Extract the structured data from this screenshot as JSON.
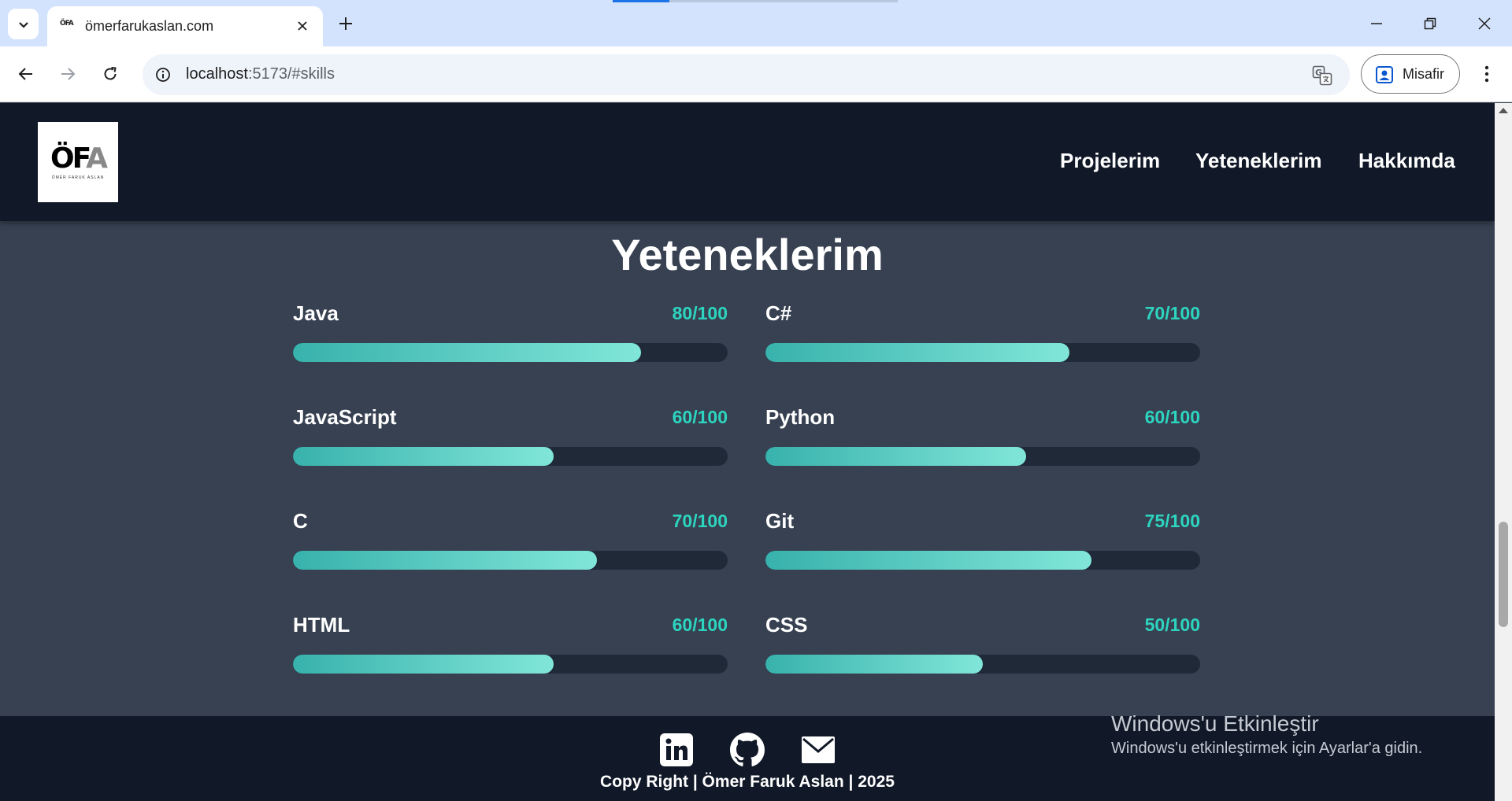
{
  "browser": {
    "tab_title": "ömerfarukaslan.com",
    "favicon_text": "ÖFA",
    "url_host": "localhost",
    "url_path": ":5173/#skills",
    "profile_label": "Misafir"
  },
  "navbar": {
    "logo_mark": "ÖF",
    "logo_mark_accent": "A",
    "logo_sub": "ÖMER FARUK ASLAN",
    "links": [
      "Projelerim",
      "Yeteneklerim",
      "Hakkımda"
    ]
  },
  "skills": {
    "title": "Yeteneklerim",
    "items": [
      {
        "name": "Java",
        "score": "80/100",
        "level": 80
      },
      {
        "name": "C#",
        "score": "70/100",
        "level": 70
      },
      {
        "name": "JavaScript",
        "score": "60/100",
        "level": 60
      },
      {
        "name": "Python",
        "score": "60/100",
        "level": 60
      },
      {
        "name": "C",
        "score": "70/100",
        "level": 70
      },
      {
        "name": "Git",
        "score": "75/100",
        "level": 75
      },
      {
        "name": "HTML",
        "score": "60/100",
        "level": 60
      },
      {
        "name": "CSS",
        "score": "50/100",
        "level": 50
      }
    ]
  },
  "footer": {
    "social_icons": [
      "linkedin-icon",
      "github-icon",
      "mail-icon"
    ],
    "copyright": "Copy Right | Ömer Faruk Aslan | 2025"
  },
  "windows_watermark": {
    "title": "Windows'u Etkinleştir",
    "subtitle": "Windows'u etkinleştirmek için Ayarlar'a gidin."
  },
  "colors": {
    "navbar_bg": "#111827",
    "page_bg": "#374151",
    "accent": "#2dd4bf",
    "bar_track": "#1f2937"
  }
}
